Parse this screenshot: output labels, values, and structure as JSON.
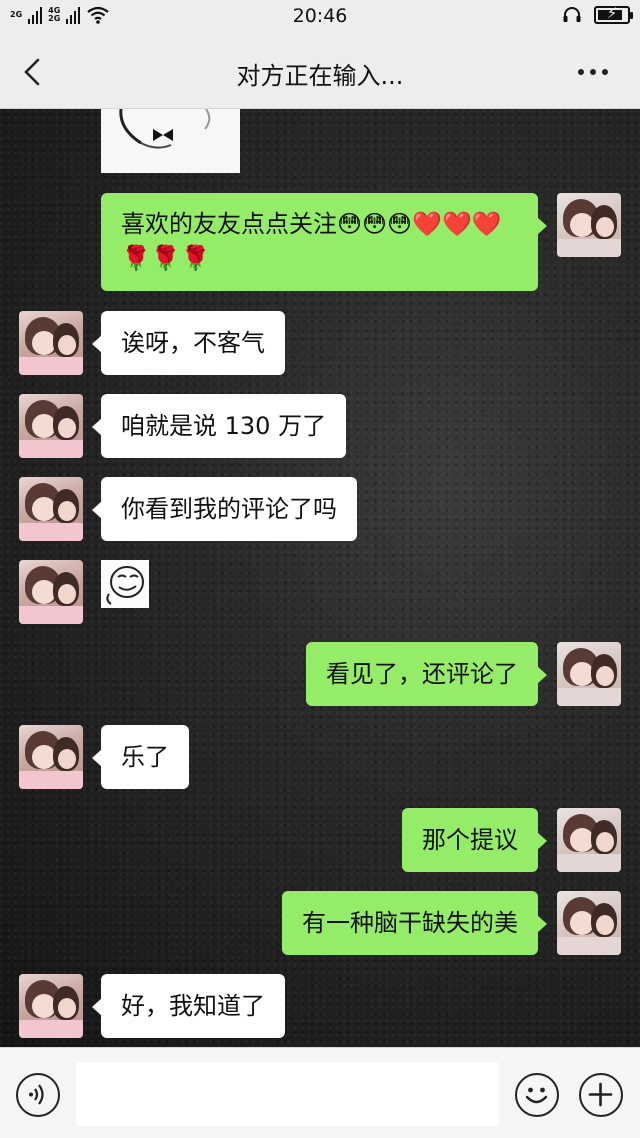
{
  "status_bar": {
    "network_1": "2G",
    "network_2a": "4G",
    "network_2b": "2G",
    "time": "20:46"
  },
  "header": {
    "title": "对方正在输入..."
  },
  "messages": [
    {
      "side": "out",
      "type": "text",
      "text": "喜欢的友友点点关注😳😳😳❤️❤️❤️🌹🌹🌹"
    },
    {
      "side": "in",
      "type": "text",
      "text": "诶呀，不客气"
    },
    {
      "side": "in",
      "type": "text",
      "text": "咱就是说 130 万了"
    },
    {
      "side": "in",
      "type": "text",
      "text": "你看到我的评论了吗"
    },
    {
      "side": "in",
      "type": "sticker",
      "icon": "smirk-face-sticker"
    },
    {
      "side": "out",
      "type": "text",
      "text": "看见了，还评论了"
    },
    {
      "side": "in",
      "type": "text",
      "text": "乐了"
    },
    {
      "side": "out",
      "type": "text",
      "text": "那个提议"
    },
    {
      "side": "out",
      "type": "text",
      "text": "有一种脑干缺失的美"
    },
    {
      "side": "in",
      "type": "text",
      "text": "好，我知道了"
    }
  ],
  "input_bar": {
    "value": "",
    "voice_icon": "voice-icon",
    "emoji_icon": "emoji-icon",
    "plus_icon": "plus-icon"
  },
  "colors": {
    "outgoing_bubble": "#95ec69",
    "incoming_bubble": "#ffffff",
    "bar_background": "#ededed"
  }
}
